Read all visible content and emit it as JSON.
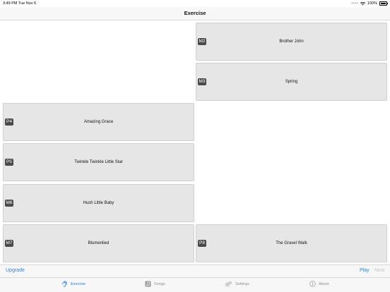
{
  "status": {
    "time": "3:49 PM",
    "date": "Tue Nov 6",
    "battery": "100%"
  },
  "nav": {
    "title": "Exercise"
  },
  "cells": [
    {
      "badge": "M2",
      "label": "Brother John"
    },
    {
      "badge": "M3",
      "label": "Spring"
    },
    {
      "badge": "P4",
      "label": "Amazing Grace"
    },
    {
      "badge": "P5",
      "label": "Twinkle Twinkle Little Star"
    },
    {
      "badge": "M6",
      "label": "Hush Little Baby"
    },
    {
      "badge": "M7",
      "label": "Blumenlied"
    },
    {
      "badge": "P8",
      "label": "The Gravel Walk"
    }
  ],
  "toolbar": {
    "upgrade": "Upgrade",
    "play": "Play",
    "next": "Next"
  },
  "tabs": [
    {
      "label": "Exercise",
      "icon": "ear-icon",
      "active": true
    },
    {
      "label": "Songs",
      "icon": "music-note-icon",
      "active": false
    },
    {
      "label": "Settings",
      "icon": "gear-icon",
      "active": false
    },
    {
      "label": "About",
      "icon": "info-icon",
      "active": false
    }
  ],
  "colors": {
    "accent": "#2f7fd6",
    "badge": "#4a4a4a",
    "cell": "#e6e6e6"
  }
}
